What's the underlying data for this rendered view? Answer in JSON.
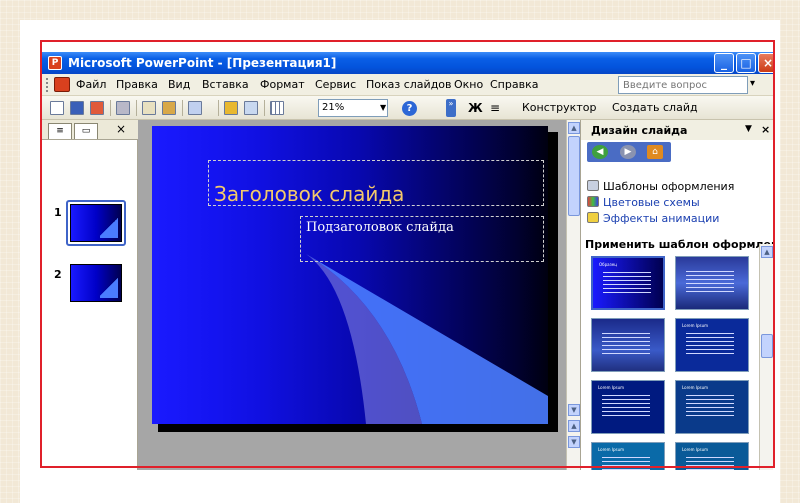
{
  "window": {
    "title": "Microsoft PowerPoint - [Презентация1]",
    "app_icon_glyph": "P"
  },
  "menubar": {
    "items": [
      "Файл",
      "Правка",
      "Вид",
      "Вставка",
      "Формат",
      "Сервис",
      "Показ слайдов",
      "Окно",
      "Справка"
    ],
    "help_placeholder": "Введите вопрос"
  },
  "toolbar": {
    "zoom": "21%",
    "bold_label": "Ж",
    "designer_label": "Конструктор",
    "new_slide_label": "Создать слайд",
    "help_glyph": "?"
  },
  "slides_pane": {
    "tab_outline_glyph": "≡",
    "tab_slides_glyph": "▭",
    "close_glyph": "×",
    "thumbnails": [
      {
        "number": "1"
      },
      {
        "number": "2"
      }
    ]
  },
  "slide": {
    "title": "Заголовок слайда",
    "subtitle": "Подзаголовок слайда"
  },
  "task_pane": {
    "title": "Дизайн слайда",
    "links": {
      "templates": "Шаблоны оформления",
      "color_schemes": "Цветовые схемы",
      "animation_effects": "Эффекты анимации"
    },
    "apply_heading": "Применить шаблон оформления:",
    "gallery": [
      {
        "text": "Образец"
      },
      {
        "text": ""
      },
      {
        "text": ""
      },
      {
        "text": "Lorem Ipsum"
      },
      {
        "text": "Lorem Ipsum"
      },
      {
        "text": "Lorem Ipsum"
      },
      {
        "text": "Lorem Ipsum"
      },
      {
        "text": "Lorem Ipsum"
      }
    ]
  },
  "colors": {
    "frame": "#e0202a",
    "title_text": "#f3c96b",
    "slide_blue": "#1a1aff"
  },
  "icons": [
    "powerpoint-icon",
    "minimize-icon",
    "maximize-icon",
    "close-icon",
    "new-icon",
    "save-icon",
    "print-icon",
    "undo-icon",
    "chart-icon",
    "table-icon",
    "grid-icon",
    "help-icon",
    "bold-icon",
    "align-icon",
    "back-icon",
    "forward-icon",
    "home-icon"
  ]
}
